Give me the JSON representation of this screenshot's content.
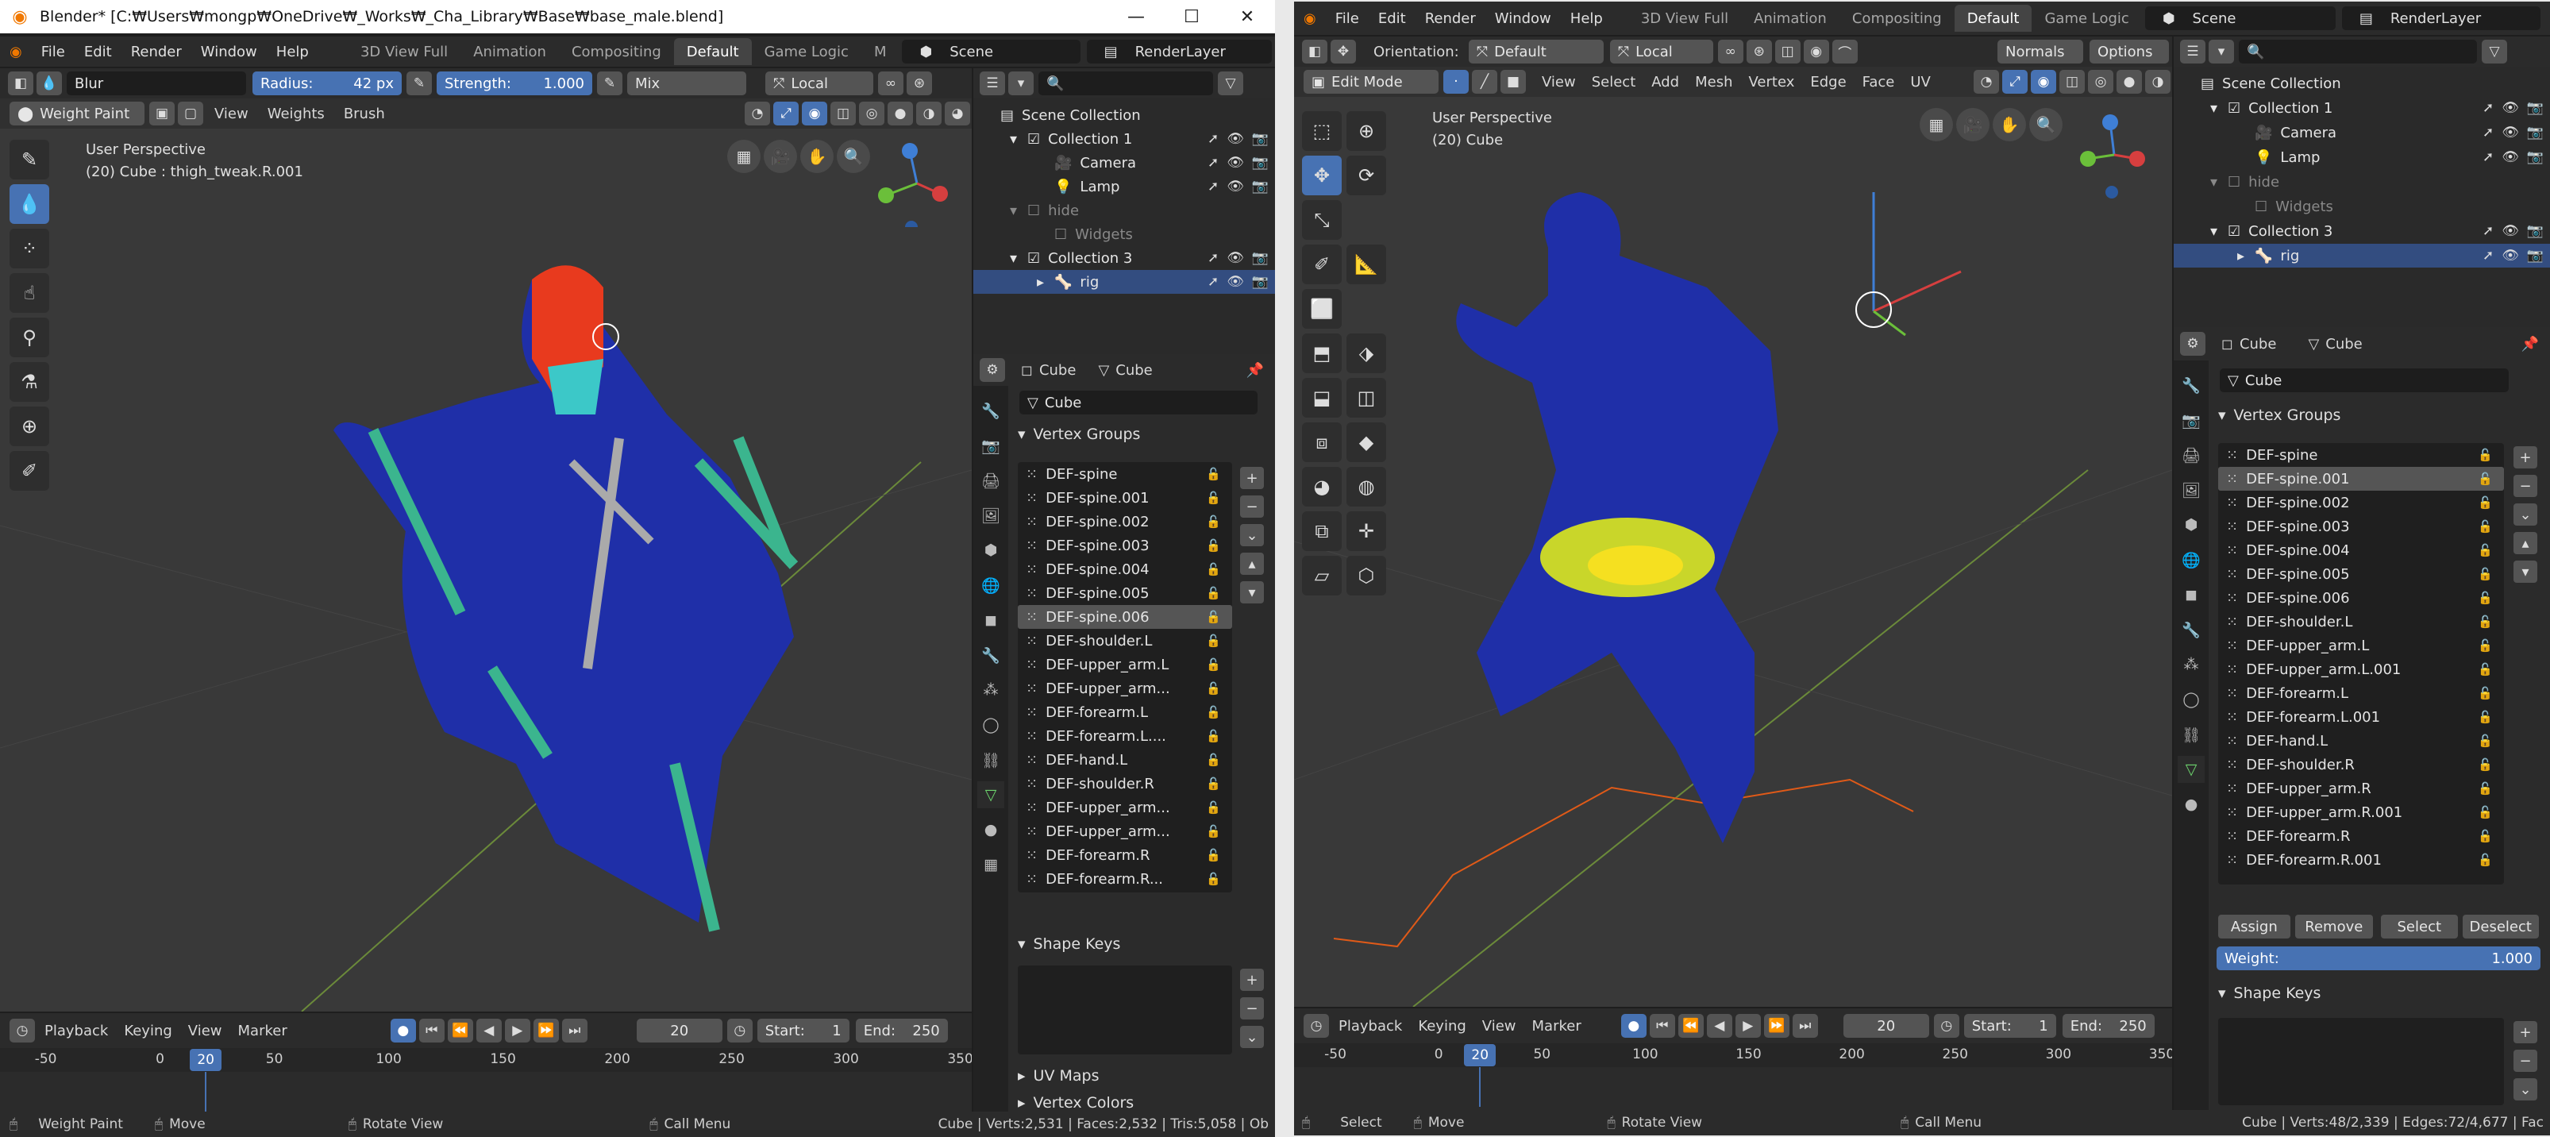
{
  "left": {
    "title": "Blender* [C:₩Users₩mongp₩OneDrive₩_Works₩_Cha_Library₩Base₩base_male.blend]",
    "menu": [
      "File",
      "Edit",
      "Render",
      "Window",
      "Help"
    ],
    "workspaces": [
      "3D View Full",
      "Animation",
      "Compositing",
      "Default",
      "Game Logic",
      "M"
    ],
    "scene": "Scene",
    "render_layer": "RenderLayer",
    "tool_header": {
      "brush": "Blur",
      "radius_label": "Radius:",
      "radius_value": "42 px",
      "strength_label": "Strength:",
      "strength_value": "1.000",
      "blend": "Mix",
      "orientation": "Local"
    },
    "mode": "Weight Paint",
    "view_menu": [
      "View",
      "Weights",
      "Brush"
    ],
    "viewport_title": "User Perspective",
    "viewport_sub": "(20) Cube : thigh_tweak.R.001",
    "outliner": [
      {
        "label": "Scene Collection",
        "indent": 0
      },
      {
        "label": "Collection 1",
        "indent": 1
      },
      {
        "label": "Camera",
        "indent": 2
      },
      {
        "label": "Lamp",
        "indent": 2
      },
      {
        "label": "hide",
        "indent": 1
      },
      {
        "label": "Widgets",
        "indent": 2
      },
      {
        "label": "Collection 3",
        "indent": 1
      },
      {
        "label": "rig",
        "indent": 2
      }
    ],
    "prop_object": "Cube",
    "prop_data": "Cube",
    "prop_name": "Cube",
    "panel_vertex_groups": "Vertex Groups",
    "vertex_groups": [
      "DEF-spine",
      "DEF-spine.001",
      "DEF-spine.002",
      "DEF-spine.003",
      "DEF-spine.004",
      "DEF-spine.005",
      "DEF-spine.006",
      "DEF-shoulder.L",
      "DEF-upper_arm.L",
      "DEF-upper_arm...",
      "DEF-forearm.L",
      "DEF-forearm.L....",
      "DEF-hand.L",
      "DEF-shoulder.R",
      "DEF-upper_arm...",
      "DEF-upper_arm...",
      "DEF-forearm.R",
      "DEF-forearm.R..."
    ],
    "selected_group": 6,
    "panel_shape_keys": "Shape Keys",
    "panel_uv_maps": "UV Maps",
    "panel_vertex_colors": "Vertex Colors",
    "timeline": {
      "menus": [
        "Playback",
        "Keying",
        "View",
        "Marker"
      ],
      "current": "20",
      "start_label": "Start:",
      "start": "1",
      "end_label": "End:",
      "end": "250",
      "ticks": [
        "-50",
        "0",
        "20",
        "50",
        "100",
        "150",
        "200",
        "250",
        "300",
        "350"
      ]
    },
    "status": {
      "mode": "Weight Paint",
      "move": "Move",
      "rotate": "Rotate View",
      "menu": "Call Menu",
      "stats": "Cube | Verts:2,531 | Faces:2,532 | Tris:5,058 | Ob"
    }
  },
  "right": {
    "menu": [
      "File",
      "Edit",
      "Render",
      "Window",
      "Help"
    ],
    "workspaces": [
      "3D View Full",
      "Animation",
      "Compositing",
      "Default",
      "Game Logic"
    ],
    "scene": "Scene",
    "render_layer": "RenderLayer",
    "header": {
      "orientation_label": "Orientation:",
      "orientation": "Default",
      "pivot": "Local",
      "normals": "Normals",
      "options": "Options"
    },
    "mode": "Edit Mode",
    "view_menu": [
      "View",
      "Select",
      "Add",
      "Mesh",
      "Vertex",
      "Edge",
      "Face",
      "UV"
    ],
    "viewport_title": "User Perspective",
    "viewport_sub": "(20) Cube",
    "outliner": [
      {
        "label": "Scene Collection",
        "indent": 0
      },
      {
        "label": "Collection 1",
        "indent": 1
      },
      {
        "label": "Camera",
        "indent": 2
      },
      {
        "label": "Lamp",
        "indent": 2
      },
      {
        "label": "hide",
        "indent": 1
      },
      {
        "label": "Widgets",
        "indent": 2
      },
      {
        "label": "Collection 3",
        "indent": 1
      },
      {
        "label": "rig",
        "indent": 2
      }
    ],
    "prop_object": "Cube",
    "prop_data": "Cube",
    "prop_name": "Cube",
    "panel_vertex_groups": "Vertex Groups",
    "vertex_groups": [
      "DEF-spine",
      "DEF-spine.001",
      "DEF-spine.002",
      "DEF-spine.003",
      "DEF-spine.004",
      "DEF-spine.005",
      "DEF-spine.006",
      "DEF-shoulder.L",
      "DEF-upper_arm.L",
      "DEF-upper_arm.L.001",
      "DEF-forearm.L",
      "DEF-forearm.L.001",
      "DEF-hand.L",
      "DEF-shoulder.R",
      "DEF-upper_arm.R",
      "DEF-upper_arm.R.001",
      "DEF-forearm.R",
      "DEF-forearm.R.001"
    ],
    "selected_group": 1,
    "buttons": {
      "assign": "Assign",
      "remove": "Remove",
      "select": "Select",
      "deselect": "Deselect"
    },
    "weight_label": "Weight:",
    "weight_value": "1.000",
    "panel_shape_keys": "Shape Keys",
    "timeline": {
      "menus": [
        "Playback",
        "Keying",
        "View",
        "Marker"
      ],
      "current": "20",
      "start_label": "Start:",
      "start": "1",
      "end_label": "End:",
      "end": "250",
      "ticks": [
        "-50",
        "0",
        "20",
        "50",
        "100",
        "150",
        "200",
        "250",
        "300",
        "350"
      ]
    },
    "status": {
      "select": "Select",
      "move": "Move",
      "rotate": "Rotate View",
      "menu": "Call Menu",
      "stats": "Cube | Verts:48/2,339 | Edges:72/4,677 | Fac"
    }
  },
  "colors": {
    "accent": "#4772b3",
    "bg": "#393939",
    "panel": "#2b2b2b",
    "selection": "#334d80"
  }
}
